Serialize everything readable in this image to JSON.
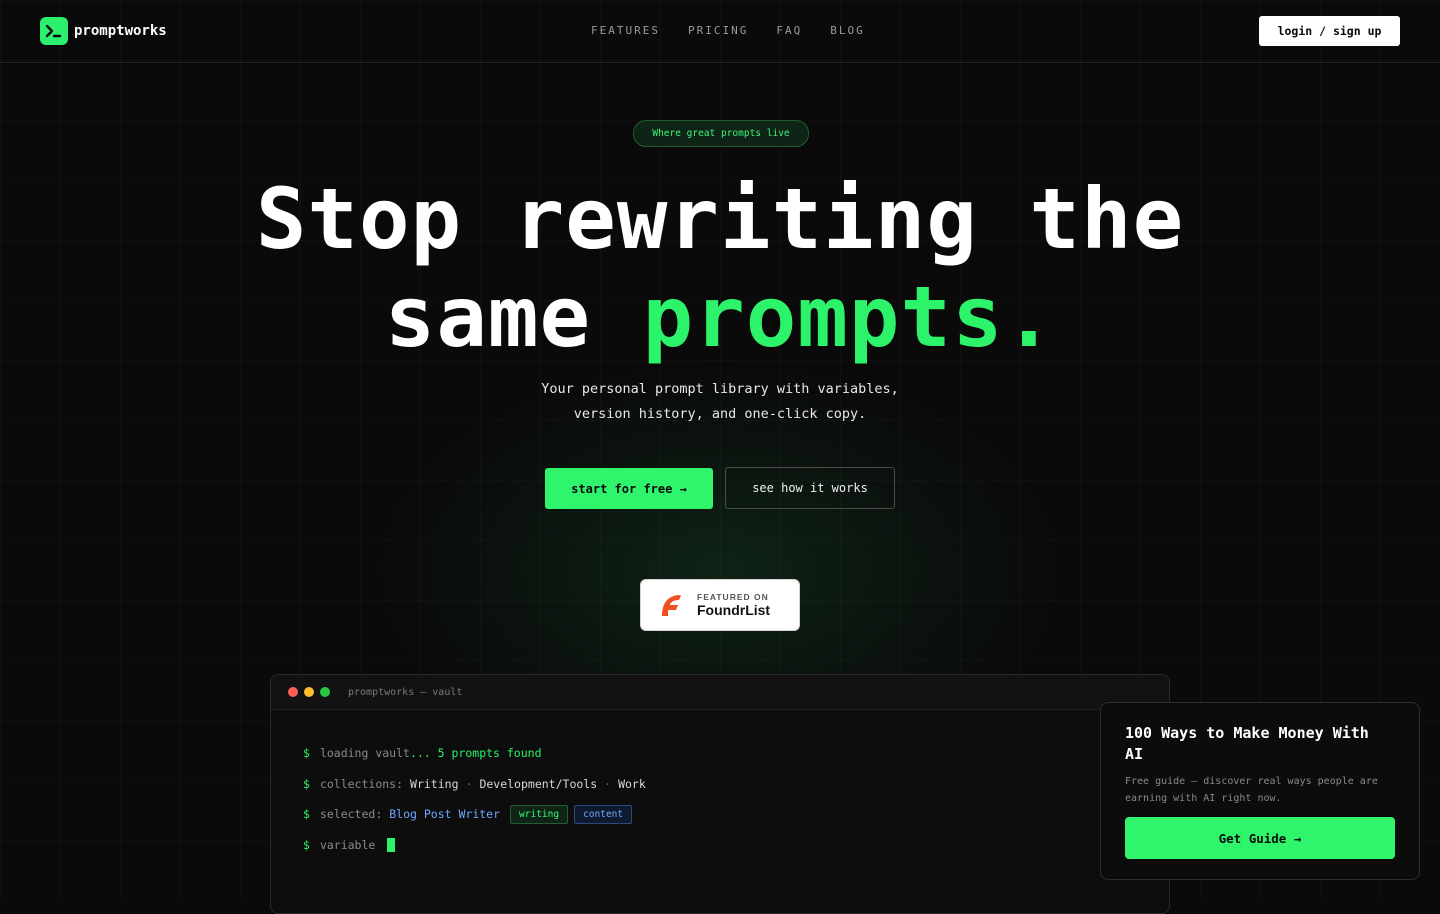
{
  "nav": {
    "brand": "promptworks",
    "links": [
      "FEATURES",
      "PRICING",
      "FAQ",
      "BLOG"
    ],
    "login_label": "login / sign up"
  },
  "hero": {
    "badge": "Where great prompts live",
    "headline_line1": "Stop rewriting the",
    "headline_line2_start": "same ",
    "headline_accent": "prompts.",
    "subtitle_line1": "Your personal prompt library with variables,",
    "subtitle_line2": "version history, and one-click copy.",
    "cta_primary": "start for free →",
    "cta_secondary": "see how it works"
  },
  "featured": {
    "small": "FEATURED ON",
    "big": "FoundrList"
  },
  "terminal": {
    "title": "promptworks — vault",
    "prompt_symbol": "$",
    "line1_label": "loading vault",
    "line1_value": "... 5 prompts found",
    "line2_label": "collections:",
    "collections": [
      "Writing",
      "Development/Tools",
      "Work"
    ],
    "collection_separator": "·",
    "line3_label": "selected:",
    "selected_value": "Blog Post Writer",
    "tags": [
      "writing",
      "content"
    ],
    "line4_label": "variable"
  },
  "popup": {
    "title": "100 Ways to Make Money With AI",
    "description": "Free guide — discover real ways people are earning with AI right now.",
    "button_label": "Get Guide →"
  },
  "colors": {
    "accent_green": "#2df36b",
    "background": "#0a0a0a",
    "tag_blue": "#6ea8ff",
    "dot_red": "#ff5f57",
    "dot_yellow": "#febc2e",
    "dot_green": "#28c840",
    "foundrlist_orange": "#f04e23"
  },
  "icons": {
    "brand_logo": "terminal-prompt-icon",
    "featured_logo": "foundrlist-f-icon"
  }
}
